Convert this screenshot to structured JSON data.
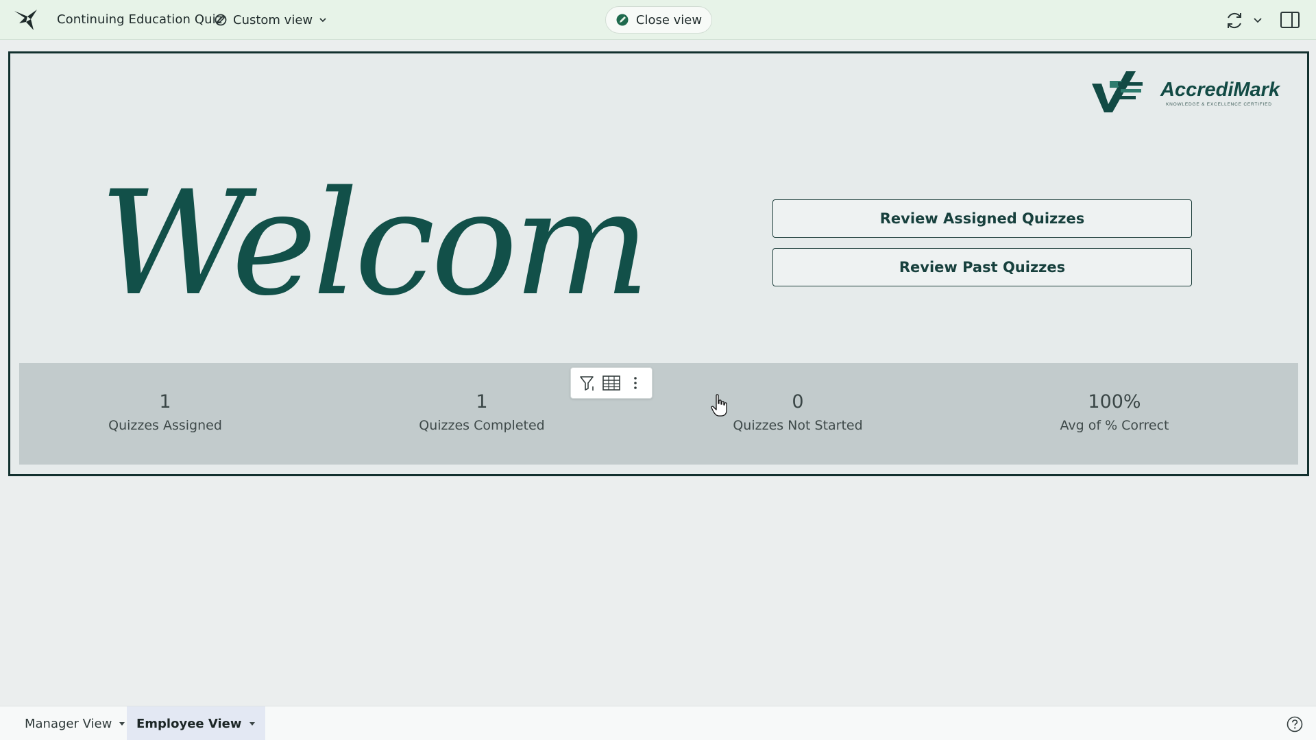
{
  "header": {
    "doc_title": "Continuing Education Quiz",
    "view_label": "Custom view",
    "close_label": "Close view"
  },
  "dashboard": {
    "welcome_text": "Welcome",
    "brand": {
      "name": "AccrediMark",
      "tagline": "KNOWLEDGE & EXCELLENCE CERTIFIED"
    },
    "buttons": {
      "review_assigned": "Review Assigned Quizzes",
      "review_past": "Review Past Quizzes"
    },
    "kpis": [
      {
        "value": "1",
        "label": "Quizzes Assigned"
      },
      {
        "value": "1",
        "label": "Quizzes Completed"
      },
      {
        "value": "0",
        "label": "Quizzes Not Started"
      },
      {
        "value": "100%",
        "label": "Avg of % Correct"
      }
    ]
  },
  "tabs": [
    {
      "label": "Manager View",
      "active": false
    },
    {
      "label": "Employee View",
      "active": true
    }
  ],
  "colors": {
    "topbar_bg": "#e7f3e8",
    "brand_teal": "#125049",
    "kpi_band": "#c2cbcc",
    "active_tab": "#e3e8f3"
  },
  "icons": [
    "app-bird-logo",
    "edit-view-icon",
    "chevron-down-icon",
    "close-view-icon",
    "refresh-icon",
    "panel-toggle-icon",
    "filter-icon",
    "table-icon",
    "more-vertical-icon",
    "help-icon",
    "pointer-cursor"
  ]
}
